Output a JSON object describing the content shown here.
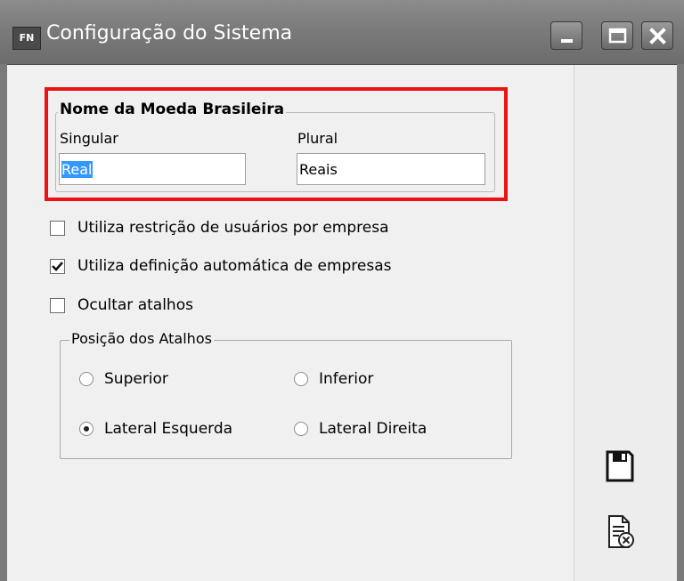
{
  "window": {
    "app_badge": "FN",
    "title": "Configuração do Sistema"
  },
  "currency_group": {
    "title": "Nome da Moeda Brasileira",
    "singular_label": "Singular",
    "singular_value": "Real",
    "plural_label": "Plural",
    "plural_value": "Reais"
  },
  "options": [
    {
      "label": "Utiliza restrição de usuários por empresa",
      "checked": false
    },
    {
      "label": "Utiliza definição automática de empresas",
      "checked": true
    },
    {
      "label": "Ocultar atalhos",
      "checked": false
    }
  ],
  "shortcuts_group": {
    "title": "Posição dos Atalhos",
    "radios": [
      {
        "label": "Superior",
        "selected": false
      },
      {
        "label": "Inferior",
        "selected": false
      },
      {
        "label": "Lateral Esquerda",
        "selected": true
      },
      {
        "label": "Lateral Direita",
        "selected": false
      }
    ]
  },
  "side_actions": [
    "save-icon",
    "cancel-document-icon"
  ],
  "colors": {
    "highlight": "#ee1111",
    "titlebar": "#7b7b7b",
    "selection": "#3399ff"
  }
}
